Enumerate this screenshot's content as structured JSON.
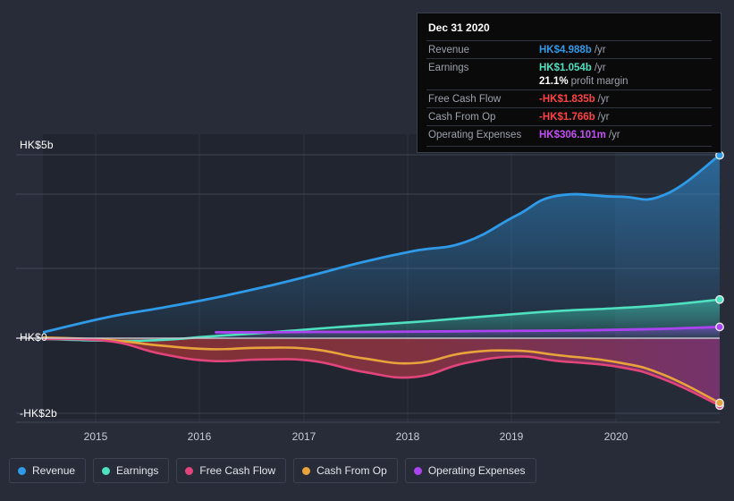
{
  "background_color": "#282c39",
  "chart_data": {
    "type": "area",
    "title": "",
    "xlabel": "",
    "ylabel": "",
    "currency": "HK$",
    "x_tick_labels": [
      "2015",
      "2016",
      "2017",
      "2018",
      "2019",
      "2020"
    ],
    "y_tick_labels": [
      "HK$5b",
      "HK$0",
      "-HK$2b"
    ],
    "ylim": [
      -2.3,
      5.5
    ],
    "grid": true,
    "legend_position": "bottom",
    "series": [
      {
        "name": "Revenue",
        "color": "#2f9ae8",
        "x": [
          2014.35,
          2015,
          2015.5,
          2016,
          2016.5,
          2017,
          2017.5,
          2018,
          2018.5,
          2019,
          2019.4,
          2020,
          2020.45,
          2021.0
        ],
        "values": [
          0.16,
          0.58,
          0.82,
          1.08,
          1.38,
          1.72,
          2.08,
          2.38,
          2.62,
          3.34,
          3.88,
          3.86,
          3.9,
          4.988
        ]
      },
      {
        "name": "Earnings",
        "color": "#4fe0c0",
        "x": [
          2014.35,
          2015,
          2015.5,
          2016,
          2016.5,
          2017,
          2017.5,
          2018,
          2018.5,
          2019,
          2019.4,
          2020,
          2020.45,
          2021.0
        ],
        "values": [
          -0.02,
          -0.07,
          -0.05,
          0.05,
          0.14,
          0.25,
          0.35,
          0.44,
          0.55,
          0.66,
          0.74,
          0.82,
          0.9,
          1.054
        ]
      },
      {
        "name": "Free Cash Flow",
        "color": "#e0457b",
        "x": [
          2014.35,
          2015,
          2015.5,
          2016,
          2016.5,
          2017,
          2017.5,
          2018,
          2018.5,
          2019,
          2019.4,
          2020,
          2020.45,
          2021.0
        ],
        "values": [
          -0.02,
          -0.08,
          -0.42,
          -0.62,
          -0.58,
          -0.62,
          -0.92,
          -1.06,
          -0.68,
          -0.5,
          -0.62,
          -0.78,
          -1.12,
          -1.835
        ]
      },
      {
        "name": "Cash From Op",
        "color": "#e8a33d",
        "x": [
          2014.35,
          2015,
          2015.5,
          2016,
          2016.5,
          2017,
          2017.5,
          2018,
          2018.5,
          2019,
          2019.4,
          2020,
          2020.45,
          2021.0
        ],
        "values": [
          0.02,
          -0.05,
          -0.2,
          -0.3,
          -0.26,
          -0.3,
          -0.55,
          -0.68,
          -0.4,
          -0.34,
          -0.46,
          -0.66,
          -1.0,
          -1.766
        ]
      },
      {
        "name": "Operating Expenses",
        "color": "#aa44ee",
        "x": [
          2016.05,
          2016.5,
          2017,
          2017.5,
          2018,
          2018.5,
          2019,
          2019.5,
          2020,
          2020.5,
          2021.0
        ],
        "values": [
          0.16,
          0.16,
          0.17,
          0.17,
          0.18,
          0.19,
          0.2,
          0.21,
          0.23,
          0.26,
          0.306
        ]
      }
    ]
  },
  "tooltip": {
    "date": "Dec 31 2020",
    "rows": [
      {
        "label": "Revenue",
        "value": "HK$4.988b",
        "unit": "/yr",
        "color": "#2f9ae8"
      },
      {
        "label": "Earnings",
        "value": "HK$1.054b",
        "unit": "/yr",
        "color": "#4fe0c0"
      },
      {
        "label": "",
        "value": "21.1%",
        "unit": "profit margin",
        "color": "#ffffff"
      },
      {
        "label": "Free Cash Flow",
        "value": "-HK$1.835b",
        "unit": "/yr",
        "color": "#ff4242"
      },
      {
        "label": "Cash From Op",
        "value": "-HK$1.766b",
        "unit": "/yr",
        "color": "#ff4242"
      },
      {
        "label": "Operating Expenses",
        "value": "HK$306.101m",
        "unit": "/yr",
        "color": "#c44ef5"
      }
    ]
  },
  "legend": {
    "items": [
      {
        "label": "Revenue",
        "color": "#2f9ae8"
      },
      {
        "label": "Earnings",
        "color": "#4fe0c0"
      },
      {
        "label": "Free Cash Flow",
        "color": "#e0457b"
      },
      {
        "label": "Cash From Op",
        "color": "#e8a33d"
      },
      {
        "label": "Operating Expenses",
        "color": "#aa44ee"
      }
    ]
  },
  "y_axis": {
    "ticks": [
      {
        "label": "HK$5b",
        "value": 5
      },
      {
        "label": "HK$0",
        "value": 0
      },
      {
        "label": "-HK$2b",
        "value": -2
      }
    ]
  },
  "x_axis": {
    "ticks": [
      {
        "label": "2015",
        "value": 2015
      },
      {
        "label": "2016",
        "value": 2016
      },
      {
        "label": "2017",
        "value": 2017
      },
      {
        "label": "2018",
        "value": 2018
      },
      {
        "label": "2019",
        "value": 2019
      },
      {
        "label": "2020",
        "value": 2020
      }
    ]
  }
}
